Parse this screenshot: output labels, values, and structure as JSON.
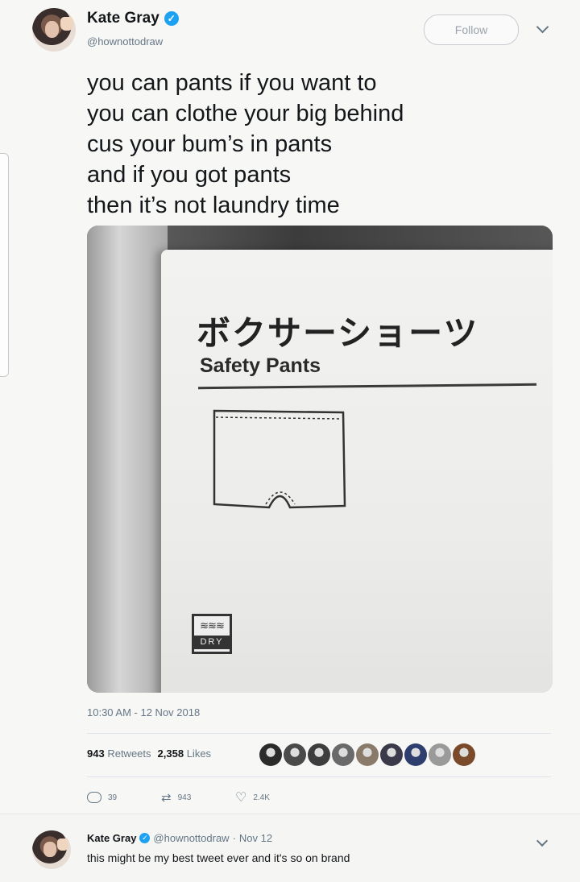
{
  "tweet": {
    "author_name": "Kate Gray",
    "handle": "@hownottodraw",
    "follow_label": "Follow",
    "lines": [
      "you can pants if you want to",
      "you can clothe your big behind",
      "cus your bum’s in pants",
      "and if you got pants",
      "then it’s not laundry time"
    ],
    "timestamp": "10:30 AM - 12 Nov 2018",
    "retweets_count": "943",
    "retweets_label": "Retweets",
    "likes_count": "2,358",
    "likes_label": "Likes",
    "reply_count": "39",
    "retweet_action_count": "943",
    "like_action_count": "2.4K"
  },
  "photo": {
    "jp_text": "ボクサーショーツ",
    "en_text": "Safety Pants",
    "badge_text": "DRY"
  },
  "likers": [
    "#2b2b2b",
    "#4a4a4a",
    "#3d3d3d",
    "#6a6a6a",
    "#8a7a6a",
    "#3a3a4a",
    "#2e3e6e",
    "#9a9a9a",
    "#7a4a2a"
  ],
  "reply": {
    "author_name": "Kate Gray",
    "handle": "@hownottodraw",
    "date": "Nov 12",
    "text": "this might be my best tweet ever and it's so on brand"
  },
  "colors": {
    "accent": "#1da1f2",
    "secondary_text": "#657786"
  }
}
